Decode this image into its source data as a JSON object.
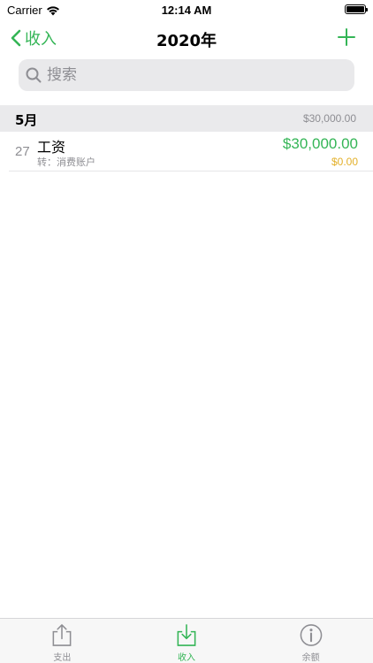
{
  "status_bar": {
    "carrier": "Carrier",
    "time": "12:14 AM"
  },
  "nav": {
    "back_label": "收入",
    "title": "2020年"
  },
  "search": {
    "placeholder": "搜索"
  },
  "section": {
    "title": "5月",
    "total": "$30,000.00"
  },
  "rows": [
    {
      "day": "27",
      "title": "工资",
      "subtitle": "转：消费账户",
      "amount": "$30,000.00",
      "balance": "$0.00"
    }
  ],
  "tabs": [
    {
      "label": "支出",
      "icon": "share-out-icon",
      "active": false
    },
    {
      "label": "收入",
      "icon": "download-in-icon",
      "active": true
    },
    {
      "label": "余额",
      "icon": "info-circle-icon",
      "active": false
    }
  ],
  "colors": {
    "accent": "#34b556",
    "balance": "#e3b02a",
    "secondary": "#8e8e93"
  }
}
